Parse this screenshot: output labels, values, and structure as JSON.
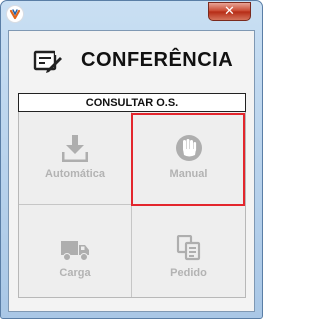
{
  "window": {
    "close_icon": "close-icon",
    "app_icon": "app-logo-icon"
  },
  "header": {
    "title": "CONFERÊNCIA",
    "icon": "form-edit-icon"
  },
  "section": {
    "label": "CONSULTAR O.S."
  },
  "tiles": [
    {
      "label": "Automática",
      "icon": "download-icon",
      "enabled": false
    },
    {
      "label": "Manual",
      "icon": "hand-stop-icon",
      "enabled": false,
      "highlighted": true
    },
    {
      "label": "Carga",
      "icon": "truck-icon",
      "enabled": false
    },
    {
      "label": "Pedido",
      "icon": "documents-icon",
      "enabled": false
    }
  ],
  "colors": {
    "highlight": "#e3262d",
    "disabled_text": "#b3b3b3",
    "disabled_icon": "#aeaeae"
  }
}
